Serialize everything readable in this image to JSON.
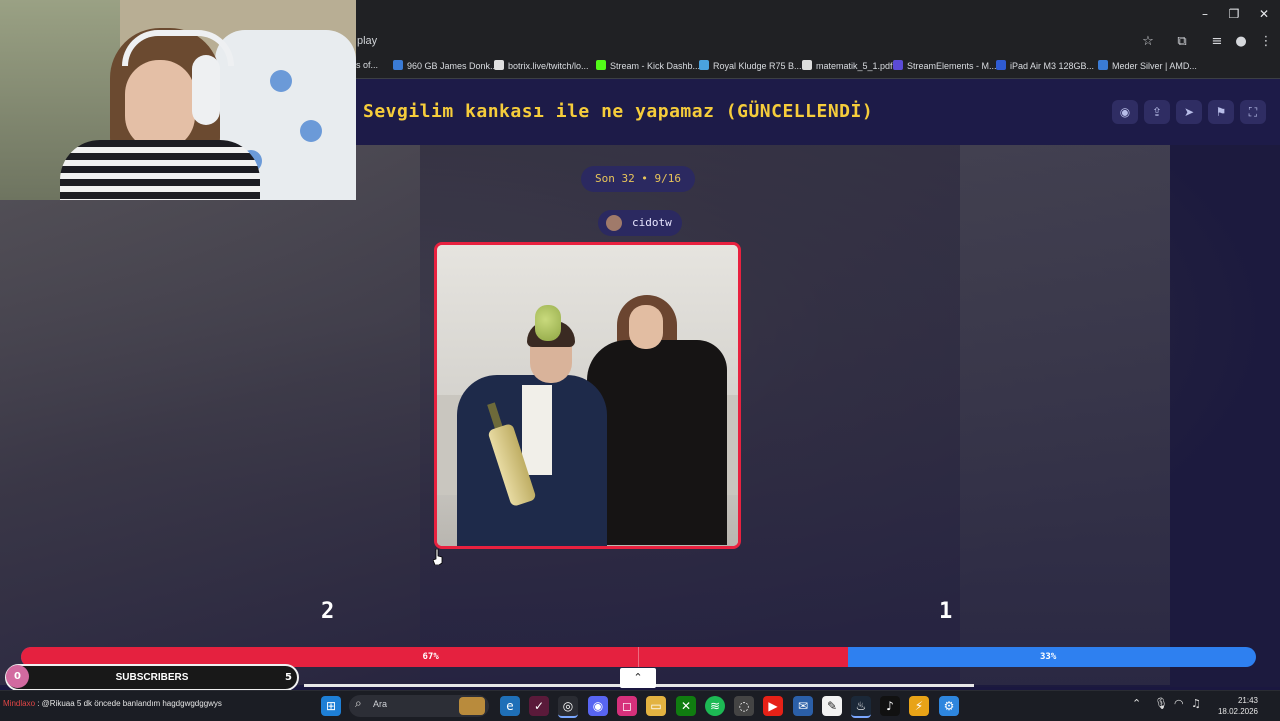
{
  "browser": {
    "url_fragment": "play",
    "window_controls": {
      "minimize": "–",
      "restore": "❐",
      "close": "✕"
    },
    "bookmarks": [
      {
        "label": "s of...",
        "color": "#888888"
      },
      {
        "label": "960 GB James Donk...",
        "color": "#3a7bd5"
      },
      {
        "label": "botrix.live/twitch/lo...",
        "color": "#e0e0e0"
      },
      {
        "label": "Stream - Kick Dashb...",
        "color": "#53fc18"
      },
      {
        "label": "Royal Kludge R75 B...",
        "color": "#4aa3df"
      },
      {
        "label": "matematik_5_1.pdf",
        "color": "#dddddd"
      },
      {
        "label": "StreamElements - M...",
        "color": "#5b4bd6"
      },
      {
        "label": "iPad Air M3 128GB...",
        "color": "#2f5bd3"
      },
      {
        "label": "Meder Silver | AMD...",
        "color": "#3a7bd5"
      }
    ]
  },
  "game": {
    "title": "Sevgilim kankası ile ne yapamaz (GÜNCELLENDİ)",
    "round": "Son 32 • 9/16",
    "submitter": "cidotw",
    "tools": [
      "eye-icon",
      "share-icon",
      "send-icon",
      "flag-icon",
      "fullscreen-icon"
    ],
    "tool_glyphs": [
      "◉",
      "⇪",
      "➤",
      "⚑",
      "⛶"
    ]
  },
  "votes": {
    "left_count": "2",
    "right_count": "1",
    "left_percent": 67,
    "right_percent": 33,
    "left_label": "67%",
    "right_label": "33%",
    "left_color": "#e5213f",
    "right_color": "#2e80f0"
  },
  "overlay": {
    "sub_goal_current": "0",
    "sub_goal_label": "SUBSCRIBERS",
    "sub_goal_target": "5",
    "scroll_up_glyph": "⌃"
  },
  "taskbar": {
    "chat_user": "Mindlaxo",
    "chat_message": " : @Rikuaa 5 dk öncede banlandım hagdgwgdggwys",
    "search_placeholder": "Ara",
    "time": "21:43",
    "date": "18.02.2026"
  }
}
